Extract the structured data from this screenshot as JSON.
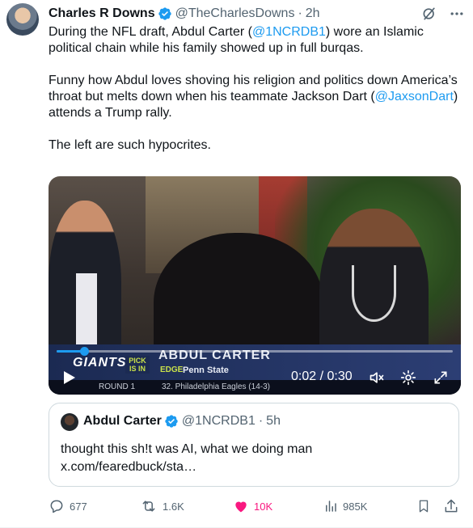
{
  "tweet": {
    "author_name": "Charles R Downs",
    "author_handle": "@TheCharlesDowns",
    "separator": "·",
    "time": "2h",
    "body": {
      "p1_a": "During the NFL draft, Abdul Carter (",
      "p1_mention": "@1NCRDB1",
      "p1_b": ") wore an Islamic political chain while his family showed up in full burqas.",
      "p2_a": "Funny how Abdul loves shoving his religion and politics down America’s throat but melts down when his teammate Jackson Dart (",
      "p2_mention": "@JaxsonDart",
      "p2_b": ") attends a Trump rally.",
      "p3": "The left are such hypocrites."
    }
  },
  "video": {
    "overlay": {
      "team": "GIANTS",
      "pick_label": "PICK IS IN",
      "player": "ABDUL CARTER",
      "position": "EDGE",
      "school": "Penn State",
      "round": "ROUND 1",
      "next_pick": "32. Philadelphia Eagles (14-3)"
    },
    "timecode": "0:02 / 0:30",
    "progress": 0.07
  },
  "quoted": {
    "author_name": "Abdul Carter",
    "author_handle": "@1NCRDB1",
    "separator": "·",
    "time": "5h",
    "text": "thought this sh!t was AI, what we doing man x.com/fearedbuck/sta…"
  },
  "actions": {
    "replies": "677",
    "reposts": "1.6K",
    "likes": "10K",
    "views": "985K"
  },
  "colors": {
    "accent": "#1d9bf0",
    "like": "#f91880",
    "muted": "#536471"
  },
  "icons": [
    "verified-icon",
    "grok-icon",
    "more-icon",
    "play-icon",
    "volume-icon",
    "settings-icon",
    "fullscreen-icon",
    "reply-icon",
    "repost-icon",
    "like-icon",
    "views-icon",
    "bookmark-icon",
    "share-icon"
  ]
}
